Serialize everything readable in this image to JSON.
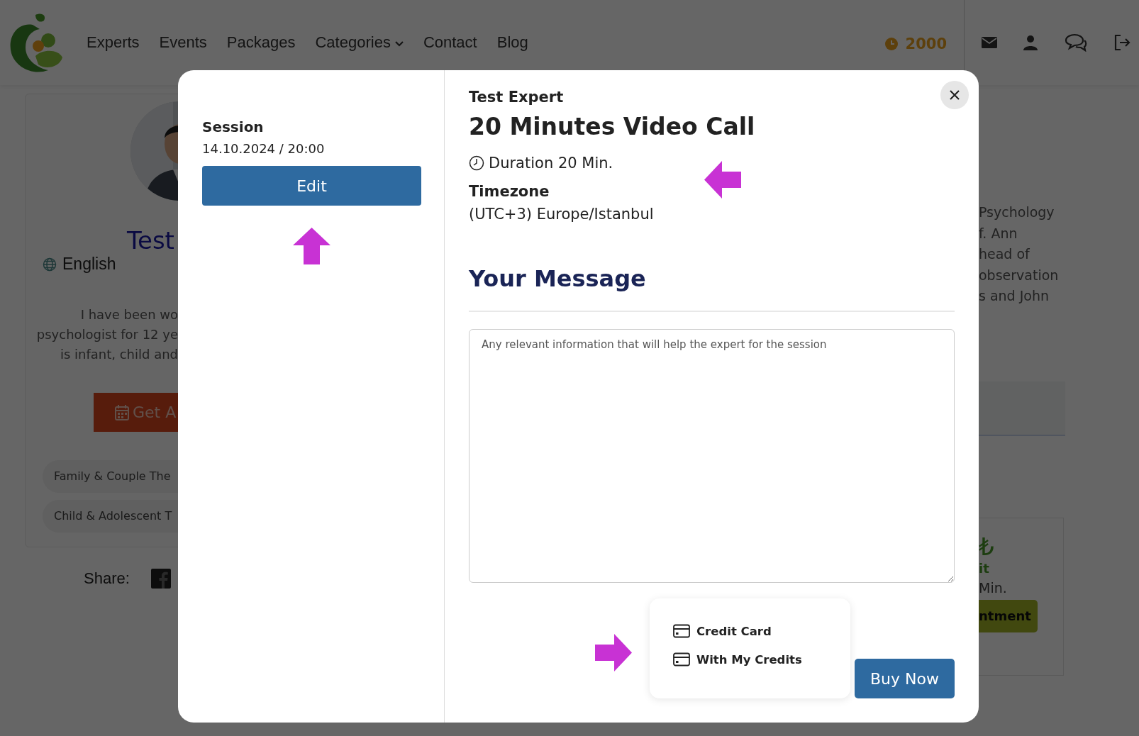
{
  "nav": {
    "links": [
      {
        "label": "Experts",
        "dropdown": false
      },
      {
        "label": "Events",
        "dropdown": false
      },
      {
        "label": "Packages",
        "dropdown": false
      },
      {
        "label": "Categories",
        "dropdown": true
      },
      {
        "label": "Contact",
        "dropdown": false
      },
      {
        "label": "Blog",
        "dropdown": false
      }
    ],
    "credits": "2000"
  },
  "background_profile": {
    "name": "Test",
    "language": "English",
    "bio_lines": [
      "I have been wo",
      "psychologist for 12 ye",
      "is infant, child and"
    ],
    "appointment_button": "Get A",
    "tags": [
      "Family & Couple The",
      "Child & Adolescent T"
    ],
    "share_label": "Share:"
  },
  "background_right": {
    "bio_lines": [
      "Psychology",
      "f. Ann",
      "head of",
      "observation",
      "s and John"
    ],
    "price_symbol": "₺",
    "price_caption": "it",
    "duration": "Min.",
    "appointment_button": "ntment"
  },
  "modal": {
    "session_label": "Session",
    "session_datetime": "14.10.2024 / 20:00",
    "edit_button": "Edit",
    "expert": "Test Expert",
    "title": "20 Minutes Video Call",
    "duration": "Duration 20 Min.",
    "timezone_label": "Timezone",
    "timezone": "(UTC+3) Europe/Istanbul",
    "message_heading": "Your Message",
    "message_placeholder": "Any relevant information that will help the expert for the session",
    "payment_options": [
      {
        "label": "Credit Card"
      },
      {
        "label": "With My Credits"
      }
    ],
    "buy_button": "Buy Now"
  },
  "annotations": {
    "edit_arrow": true,
    "details_arrow": true,
    "payment_arrow": true
  }
}
